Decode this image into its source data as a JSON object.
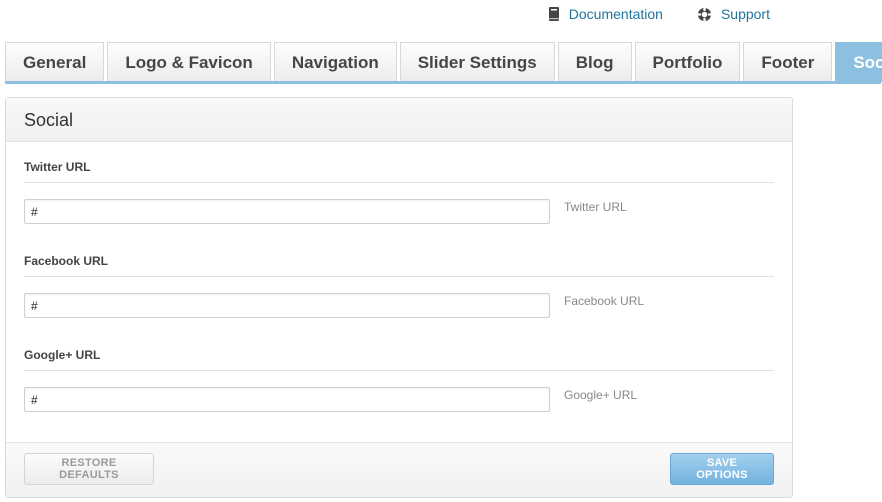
{
  "toplinks": {
    "documentation": {
      "label": "Documentation",
      "icon": "book-icon"
    },
    "support": {
      "label": "Support",
      "icon": "lifebuoy-icon"
    }
  },
  "tabs": [
    {
      "label": "General",
      "active": false
    },
    {
      "label": "Logo & Favicon",
      "active": false
    },
    {
      "label": "Navigation",
      "active": false
    },
    {
      "label": "Slider Settings",
      "active": false
    },
    {
      "label": "Blog",
      "active": false
    },
    {
      "label": "Portfolio",
      "active": false
    },
    {
      "label": "Footer",
      "active": false
    },
    {
      "label": "Social",
      "active": true
    }
  ],
  "panel": {
    "title": "Social",
    "fields": [
      {
        "label": "Twitter URL",
        "value": "#",
        "description": "Twitter URL"
      },
      {
        "label": "Facebook URL",
        "value": "#",
        "description": "Facebook URL"
      },
      {
        "label": "Google+ URL",
        "value": "#",
        "description": "Google+ URL"
      }
    ]
  },
  "buttons": {
    "restore": "RESTORE DEFAULTS",
    "save": "SAVE OPTIONS"
  },
  "colors": {
    "accent": "#8cbfe0",
    "link": "#21759b",
    "save_button": "#74b2df"
  }
}
